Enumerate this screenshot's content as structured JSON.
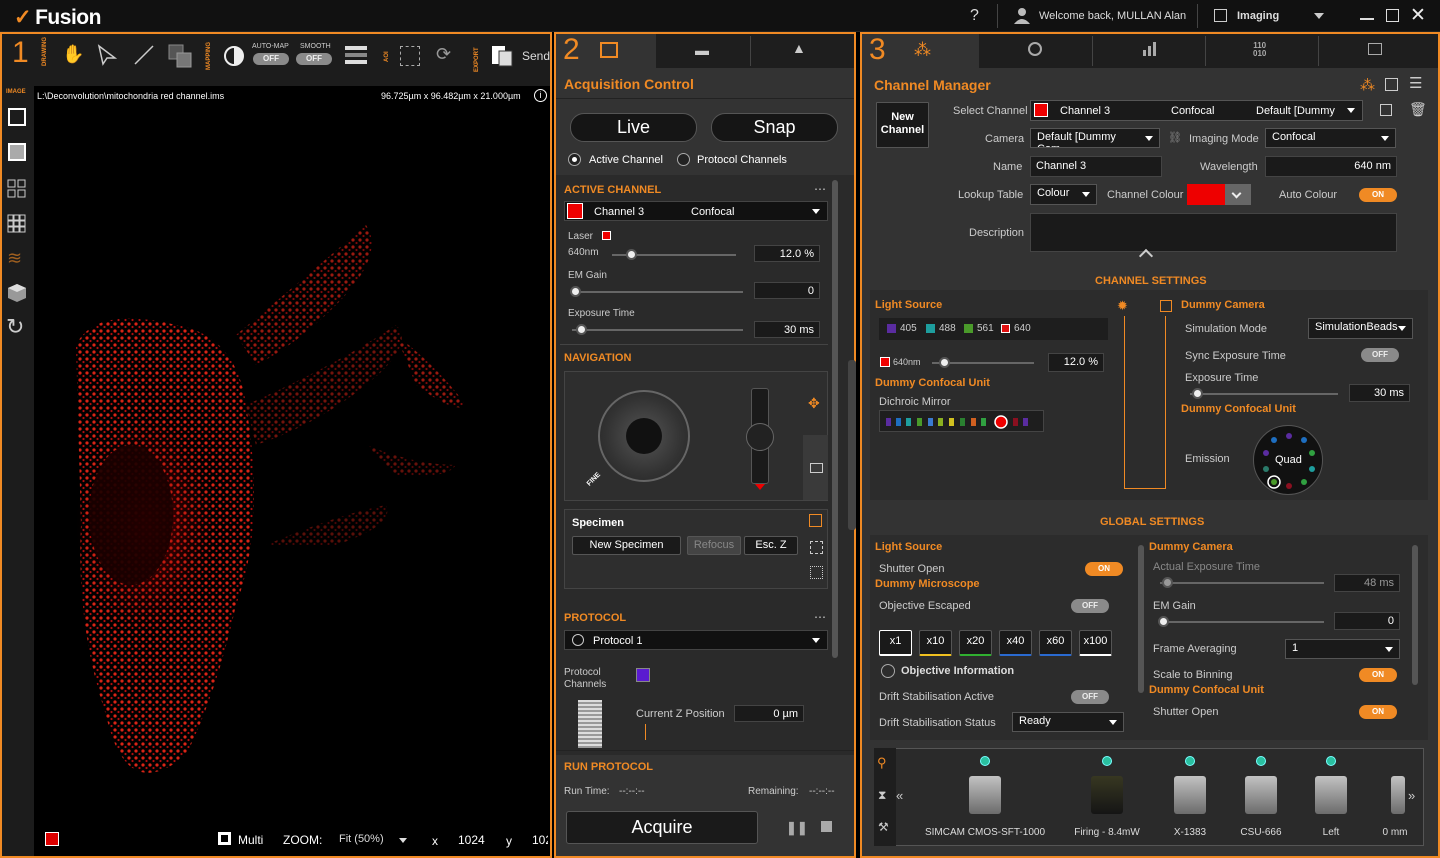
{
  "app": {
    "name": "Fusion",
    "help": "?",
    "welcome": "Welcome back, MULLAN Alan",
    "mode": "Imaging"
  },
  "panel1": {
    "number": "1",
    "groups": {
      "drawing": "DRAWING",
      "mapping": "MAPPING",
      "aoi": "AOI",
      "export": "EXPORT",
      "image": "IMAGE"
    },
    "automap_label": "AUTO-MAP",
    "smooth_label": "SMOOTH",
    "automap": "OFF",
    "smooth": "OFF",
    "send": "Send",
    "path": "L:\\Deconvolution\\mitochondria red channel.ims",
    "dims": "96.725µm x 96.482µm x 21.000µm",
    "footer": {
      "multi": "Multi",
      "zoom_label": "ZOOM:",
      "zoom": "Fit (50%)",
      "x_label": "x",
      "x": "1024",
      "y_label": "y",
      "y": "102"
    }
  },
  "panel2": {
    "number": "2",
    "title": "Acquisition Control",
    "live": "Live",
    "snap": "Snap",
    "radio_active": "Active Channel",
    "radio_protocol": "Protocol Channels",
    "active_channel": {
      "header": "ACTIVE CHANNEL",
      "name": "Channel 3",
      "mode": "Confocal",
      "laser": "Laser",
      "laser_wl": "640nm",
      "laser_val": "12.0 %",
      "em_gain": "EM Gain",
      "em_val": "0",
      "exposure": "Exposure Time",
      "exposure_val": "30 ms"
    },
    "navigation": {
      "header": "NAVIGATION",
      "fine": "FINE"
    },
    "specimen": {
      "header": "Specimen",
      "new": "New Specimen",
      "refocus": "Refocus",
      "esc": "Esc. Z"
    },
    "protocol": {
      "header": "PROTOCOL",
      "name": "Protocol 1",
      "channels_label": "Protocol Channels",
      "z_label": "Current Z Position",
      "z_val": "0 µm"
    },
    "run": {
      "header": "RUN PROTOCOL",
      "run_time_label": "Run Time:",
      "run_time": "--:--:--",
      "remaining_label": "Remaining:",
      "remaining": "--:--:--"
    },
    "acquire": "Acquire"
  },
  "panel3": {
    "number": "3",
    "title": "Channel Manager",
    "new_channel": "New Channel",
    "select_channel_label": "Select Channel",
    "channel": "Channel 3",
    "channel_mode": "Confocal",
    "channel_camera": "Default [Dummy",
    "camera_label": "Camera",
    "camera": "Default [Dummy Cam",
    "imaging_mode_label": "Imaging Mode",
    "imaging_mode": "Confocal",
    "name_label": "Name",
    "name": "Channel 3",
    "wavelength_label": "Wavelength",
    "wavelength": "640 nm",
    "lut_label": "Lookup Table",
    "lut": "Colour",
    "channel_colour_label": "Channel Colour",
    "auto_colour_label": "Auto Colour",
    "auto_colour": "ON",
    "description_label": "Description",
    "channel_settings": "CHANNEL SETTINGS",
    "cs": {
      "light_source": "Light Source",
      "lines": [
        "405",
        "488",
        "561",
        "640"
      ],
      "line_colors": [
        "#5a2ca0",
        "#1e9e9e",
        "#4a9a2a",
        "#e01010"
      ],
      "laser_wl": "640nm",
      "laser_val": "12.0 %",
      "confocal_unit": "Dummy Confocal Unit",
      "dichroic": "Dichroic Mirror",
      "camera": "Dummy Camera",
      "sim_mode_label": "Simulation Mode",
      "sim_mode": "SimulationBeads",
      "sync_label": "Sync Exposure Time",
      "sync": "OFF",
      "exposure_label": "Exposure Time",
      "exposure": "30 ms",
      "confocal_unit2": "Dummy Confocal Unit",
      "emission_label": "Emission",
      "emission": "Quad"
    },
    "global_settings": "GLOBAL SETTINGS",
    "gs": {
      "light_source": "Light Source",
      "shutter_label": "Shutter Open",
      "shutter": "ON",
      "microscope": "Dummy Microscope",
      "obj_escaped_label": "Objective Escaped",
      "obj_escaped": "OFF",
      "objectives": [
        "x1",
        "x10",
        "x20",
        "x40",
        "x60",
        "x100"
      ],
      "objective_colors": [
        "#ffffff",
        "#f0c020",
        "#30b030",
        "#2a6ad0",
        "#2a6ad0",
        "#ffffff"
      ],
      "obj_info": "Objective Information",
      "drift_active_label": "Drift Stabilisation Active",
      "drift_active": "OFF",
      "drift_status_label": "Drift Stabilisation Status",
      "drift_status": "Ready",
      "camera": "Dummy Camera",
      "actual_exposure_label": "Actual Exposure Time",
      "actual_exposure": "48 ms",
      "em_gain_label": "EM Gain",
      "em_gain": "0",
      "frame_avg_label": "Frame Averaging",
      "frame_avg": "1",
      "binning_label": "Scale to Binning",
      "binning": "ON",
      "confocal_unit": "Dummy Confocal Unit",
      "shutter2_label": "Shutter Open",
      "shutter2": "ON"
    },
    "devices": [
      "SIMCAM CMOS-SFT-1000",
      "Firing - 8.4mW",
      "X-1383",
      "CSU-666",
      "Left",
      "0 mm"
    ]
  }
}
